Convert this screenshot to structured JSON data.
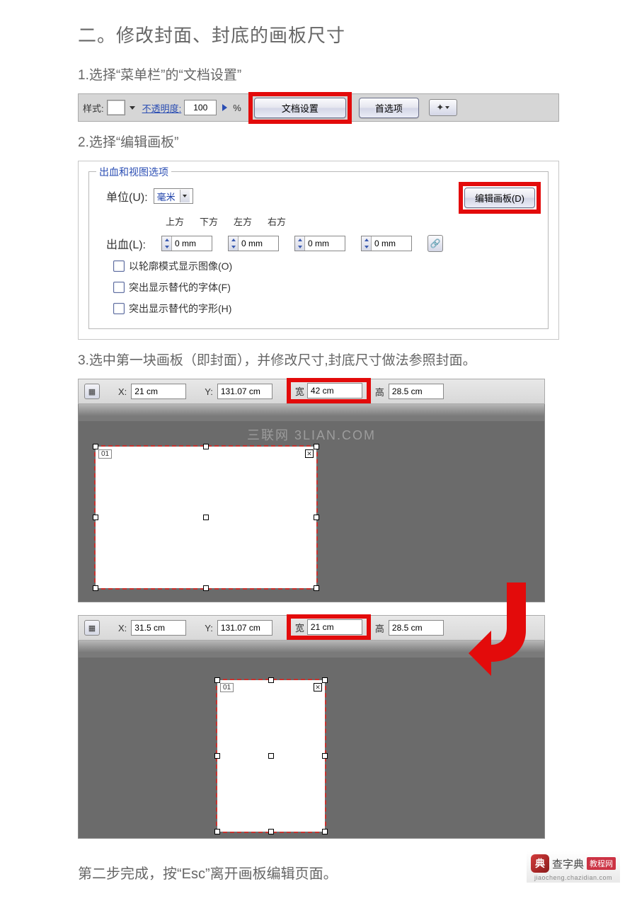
{
  "section_title": "二。修改封面、封底的画板尺寸",
  "step1": "1.选择“菜单栏”的“文档设置”",
  "step2": "2.选择“编辑画板”",
  "step3": "3.选中第一块画板（即封面），并修改尺寸,封底尺寸做法参照封面。",
  "footer_text": "第二步完成，按“Esc”离开画板编辑页面。",
  "toolbar": {
    "style_label": "样式:",
    "opacity_label": "不透明度:",
    "opacity_value": "100",
    "opacity_unit": "%",
    "doc_settings_btn": "文档设置",
    "prefs_btn": "首选项"
  },
  "panel": {
    "legend": "出血和视图选项",
    "unit_label": "单位(U):",
    "unit_value": "毫米",
    "edit_artboard_btn": "编辑画板(D)",
    "bleed_label": "出血(L):",
    "headers": {
      "top": "上方",
      "bottom": "下方",
      "left": "左方",
      "right": "右方"
    },
    "bleed_values": {
      "top": "0 mm",
      "bottom": "0 mm",
      "left": "0 mm",
      "right": "0 mm"
    },
    "chk_outline": "以轮廓模式显示图像(O)",
    "chk_font_sub": "突出显示替代的字体(F)",
    "chk_glyph_sub": "突出显示替代的字形(H)"
  },
  "artboard1": {
    "x_label": "X:",
    "x_value": "21 cm",
    "y_label": "Y:",
    "y_value": "131.07 cm",
    "w_label": "宽",
    "w_value": "42 cm",
    "h_label": "高",
    "h_value": "28.5 cm",
    "artboard_num": "01",
    "watermark": "三联网  3LIAN.COM"
  },
  "artboard2": {
    "x_label": "X:",
    "x_value": "31.5 cm",
    "y_label": "Y:",
    "y_value": "131.07 cm",
    "w_label": "宽",
    "w_value": "21 cm",
    "h_label": "高",
    "h_value": "28.5 cm",
    "artboard_num": "01"
  },
  "logo": {
    "brand": "查字典",
    "badge": "教程网",
    "url": "jiaocheng.chazidian.com"
  }
}
